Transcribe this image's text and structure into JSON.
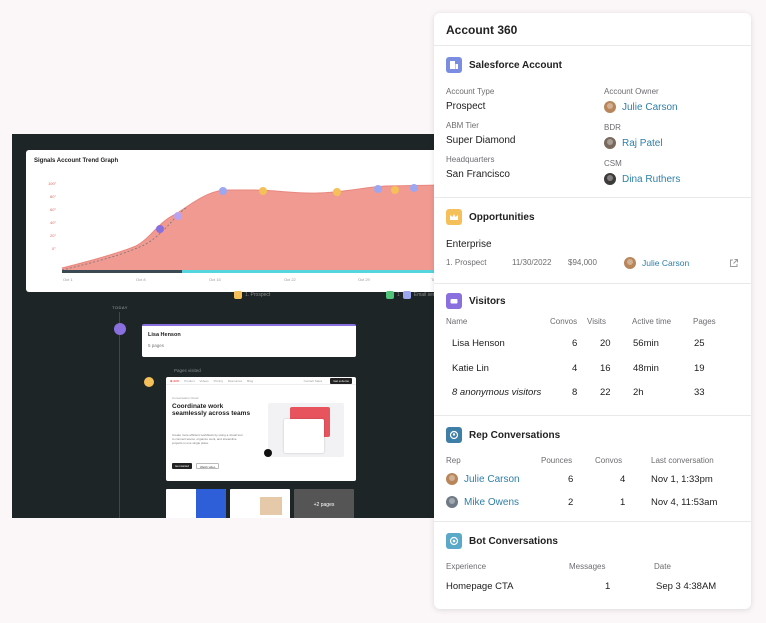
{
  "trend": {
    "title": "Signals Account Trend Graph",
    "y_ticks": [
      "100°",
      "80°",
      "60°",
      "40°",
      "20°",
      "0°"
    ],
    "x_ticks": [
      "Oct 1",
      "Oct 8",
      "Oct 15",
      "Oct 22",
      "Oct 29",
      "Today"
    ],
    "legend_prospect": "1. Prospect",
    "legend_email_num": "1",
    "legend_email": "Email sent"
  },
  "timeline": {
    "today": "TODAY",
    "visitor_name": "Lisa Henson",
    "visitor_pages": "5 pages",
    "pages_visited": "Pages visited",
    "site": {
      "logo": "⊛ drift",
      "nav": [
        "Product",
        "Videos",
        "Pricing",
        "Resources",
        "Blog"
      ],
      "nav_right": "Contact Sales",
      "cta": "Get a demo",
      "kicker": "Conversation Cloud",
      "headline": "Coordinate work seamlessly across teams",
      "body": "Create more efficient workflows by using a visual tool to connect teams, organize work, and streamline projects in one single place.",
      "btn_primary": "Get started",
      "btn_secondary": "Watch video"
    },
    "more_pages": "+2 pages"
  },
  "panel": {
    "title": "Account 360",
    "salesforce": {
      "heading": "Salesforce Account",
      "account_type_label": "Account Type",
      "account_type": "Prospect",
      "abm_tier_label": "ABM Tier",
      "abm_tier": "Super Diamond",
      "hq_label": "Headquarters",
      "hq": "San Francisco",
      "owner_label": "Account Owner",
      "owner": "Julie Carson",
      "bdr_label": "BDR",
      "bdr": "Raj Patel",
      "csm_label": "CSM",
      "csm": "Dina Ruthers"
    },
    "opportunities": {
      "heading": "Opportunities",
      "name": "Enterprise",
      "stage": "1. Prospect",
      "date": "11/30/2022",
      "amount": "$94,000",
      "owner": "Julie Carson"
    },
    "visitors": {
      "heading": "Visitors",
      "columns": [
        "Name",
        "Convos",
        "Visits",
        "Active time",
        "Pages"
      ],
      "rows": [
        {
          "name": "Lisa Henson",
          "convos": "6",
          "visits": "20",
          "active": "56min",
          "pages": "25"
        },
        {
          "name": "Katie Lin",
          "convos": "4",
          "visits": "16",
          "active": "48min",
          "pages": "19"
        },
        {
          "name": "8 anonymous visitors",
          "convos": "8",
          "visits": "22",
          "active": "2h",
          "pages": "33"
        }
      ]
    },
    "rep_conversations": {
      "heading": "Rep Conversations",
      "columns": [
        "Rep",
        "Pounces",
        "Convos",
        "Last conversation"
      ],
      "rows": [
        {
          "rep": "Julie Carson",
          "pounces": "6",
          "convos": "4",
          "last": "Nov 1, 1:33pm"
        },
        {
          "rep": "Mike Owens",
          "pounces": "2",
          "convos": "1",
          "last": "Nov 4, 11:53am"
        }
      ]
    },
    "bot_conversations": {
      "heading": "Bot Conversations",
      "columns": [
        "Experience",
        "Messages",
        "Date"
      ],
      "rows": [
        {
          "experience": "Homepage CTA",
          "messages": "1",
          "date": "Sep 3 4:38AM"
        }
      ]
    }
  },
  "colors": {
    "salesforce_icon": "#7b8de0",
    "opportunities_icon": "#f5c05a",
    "visitors_icon": "#8a6fdf",
    "rep_icon": "#3f7ea6",
    "bot_icon": "#5aa9c9",
    "link": "#2f7fa8",
    "area_fill": "#f19a92"
  },
  "icons": [
    "salesforce-icon",
    "crown-icon",
    "visitor-icon",
    "rep-chat-icon",
    "bot-icon",
    "external-link-icon",
    "avatar"
  ]
}
